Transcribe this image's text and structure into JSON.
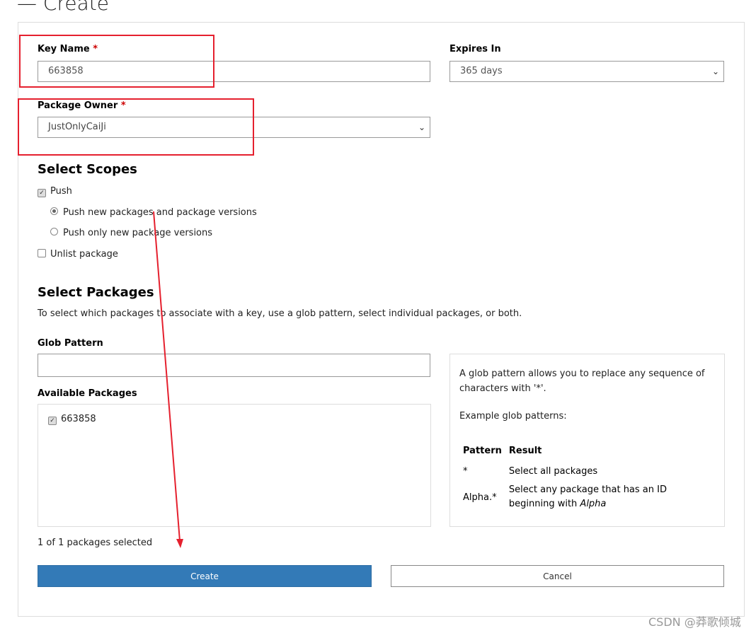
{
  "page": {
    "title": "Create",
    "collapse_glyph": "—"
  },
  "form": {
    "key_name": {
      "label": "Key Name",
      "required": "*",
      "value": "663858"
    },
    "expires_in": {
      "label": "Expires In",
      "value": "365 days"
    },
    "package_owner": {
      "label": "Package Owner",
      "required": "*",
      "value": "JustOnlyCaiJi"
    },
    "scopes": {
      "heading": "Select Scopes",
      "push": {
        "label": "Push",
        "checked": true
      },
      "push_options": [
        {
          "label": "Push new packages and package versions",
          "selected": true
        },
        {
          "label": "Push only new package versions",
          "selected": false
        }
      ],
      "unlist": {
        "label": "Unlist package",
        "checked": false
      }
    },
    "packages": {
      "heading": "Select Packages",
      "description": "To select which packages to associate with a key, use a glob pattern, select individual packages, or both.",
      "glob_label": "Glob Pattern",
      "glob_value": "",
      "available_label": "Available Packages",
      "items": [
        {
          "label": "663858",
          "checked": true
        }
      ],
      "selected_count": "1 of 1 packages selected"
    },
    "help": {
      "intro": "A glob pattern allows you to replace any sequence of characters with '*'.",
      "examples_label": "Example glob patterns:",
      "headers": [
        "Pattern",
        "Result"
      ],
      "rows": [
        {
          "pattern": "*",
          "result": "Select all packages"
        },
        {
          "pattern": "Alpha.*",
          "result": "Select any package that has an ID beginning with ",
          "result_em": "Alpha"
        }
      ]
    },
    "create_label": "Create",
    "cancel_label": "Cancel"
  },
  "watermark": "CSDN @莽歌倾城",
  "colors": {
    "primary": "#337ab7",
    "annotation": "#e5202e"
  }
}
